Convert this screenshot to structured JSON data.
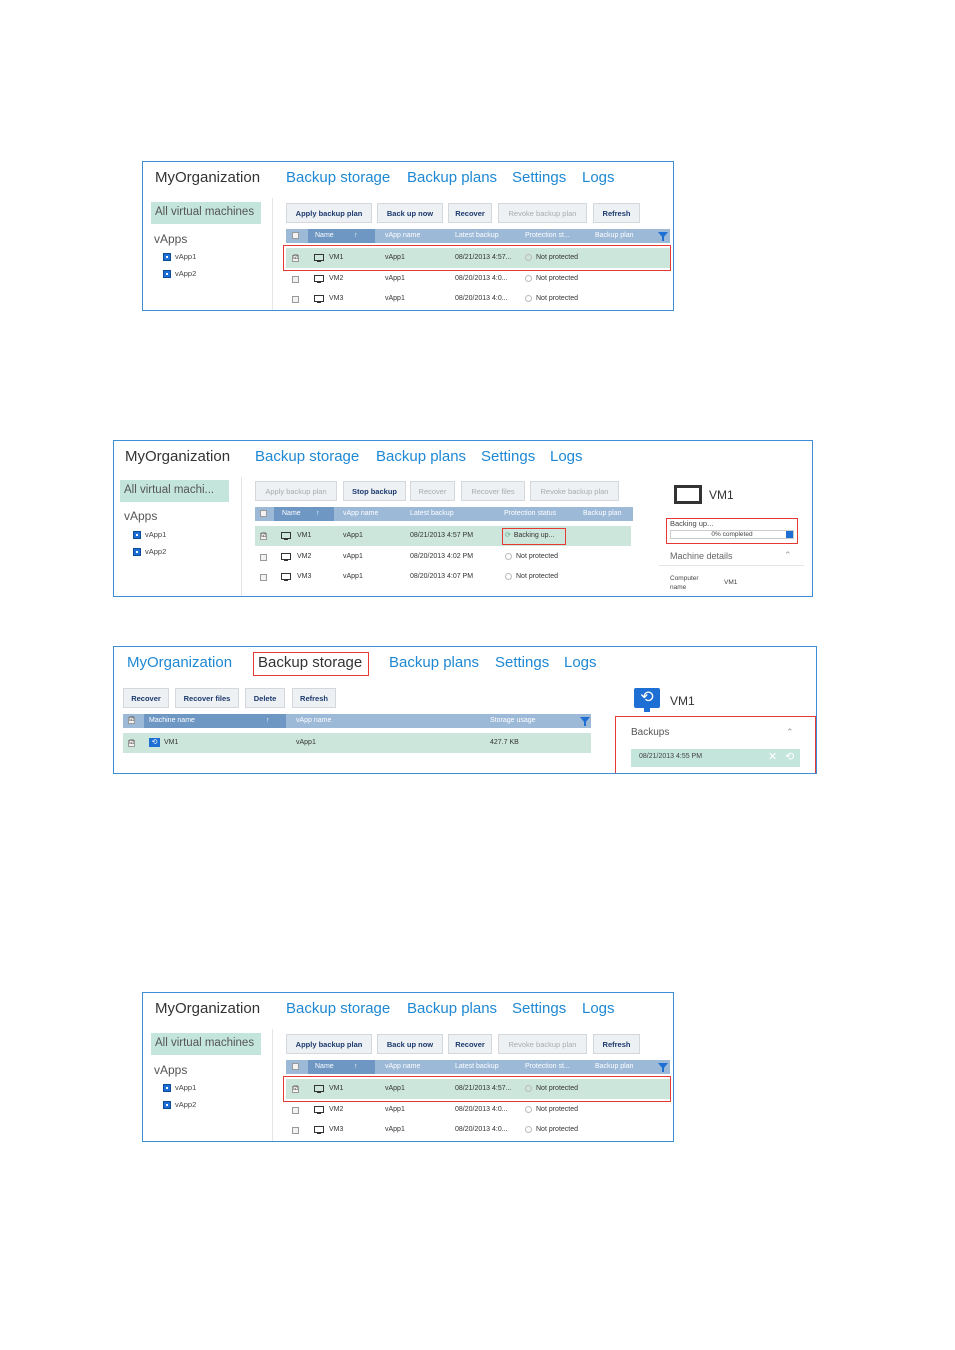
{
  "nav": {
    "org": "MyOrganization",
    "links": [
      "Backup storage",
      "Backup plans",
      "Settings",
      "Logs"
    ]
  },
  "sidebar": {
    "all_vms": "All virtual machines",
    "all_vms_truncated": "All virtual machi...",
    "vapps_label": "vApps",
    "vapps": [
      "vApp1",
      "vApp2"
    ]
  },
  "shot1": {
    "buttons": [
      "Apply backup plan",
      "Back up now",
      "Recover",
      "Revoke backup plan",
      "Refresh"
    ],
    "columns": [
      "Name",
      "vApp name",
      "Latest backup",
      "Protection st...",
      "Backup plan"
    ],
    "rows": [
      {
        "name": "VM1",
        "vapp": "vApp1",
        "latest": "08/21/2013 4:57...",
        "status": "Not protected",
        "checked": "☑"
      },
      {
        "name": "VM2",
        "vapp": "vApp1",
        "latest": "08/20/2013 4:0...",
        "status": "Not protected",
        "checked": ""
      },
      {
        "name": "VM3",
        "vapp": "vApp1",
        "latest": "08/20/2013 4:0...",
        "status": "Not protected",
        "checked": ""
      }
    ]
  },
  "shot2": {
    "buttons": [
      "Apply backup plan",
      "Stop backup",
      "Recover",
      "Recover files",
      "Revoke backup plan"
    ],
    "columns": [
      "Name",
      "vApp name",
      "Latest backup",
      "Protection status",
      "Backup plan"
    ],
    "rows": [
      {
        "name": "VM1",
        "vapp": "vApp1",
        "latest": "08/21/2013 4:57 PM",
        "status": "Backing up...",
        "checked": "☑"
      },
      {
        "name": "VM2",
        "vapp": "vApp1",
        "latest": "08/20/2013 4:02 PM",
        "status": "Not protected",
        "checked": ""
      },
      {
        "name": "VM3",
        "vapp": "vApp1",
        "latest": "08/20/2013 4:07 PM",
        "status": "Not protected",
        "checked": ""
      }
    ],
    "details": {
      "vm_name": "VM1",
      "progress_label": "Backing up...",
      "progress_text": "0% completed",
      "progress_fraction": 0,
      "machine_details": "Machine details",
      "computer_name_label": "Computer name",
      "computer_name_value": "VM1"
    }
  },
  "shot3": {
    "buttons": [
      "Recover",
      "Recover files",
      "Delete",
      "Refresh"
    ],
    "columns": [
      "Machine name",
      "vApp name",
      "Storage usage"
    ],
    "rows": [
      {
        "name": "VM1",
        "vapp": "vApp1",
        "usage": "427.7 KB",
        "checked": "☑"
      }
    ],
    "details": {
      "vm_name": "VM1",
      "backups_label": "Backups",
      "backup_entry": "08/21/2013 4:55 PM"
    }
  },
  "colors": {
    "accent": "#1e88d4",
    "selection": "#c4e5db",
    "header": "#9cb9d8",
    "highlight": "#e53935"
  }
}
